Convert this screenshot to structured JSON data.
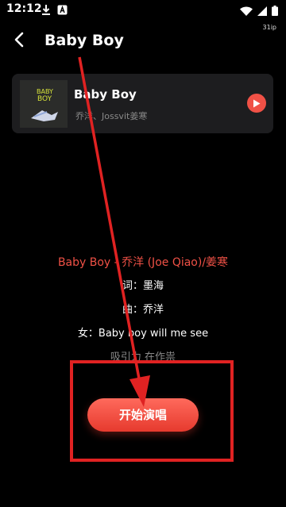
{
  "status_bar": {
    "time": "12:12",
    "net_speed": "31ip",
    "left_icons": [
      "download-icon",
      "a-badge-icon"
    ],
    "right_icons": [
      "wifi-icon",
      "signal-icon",
      "battery-icon"
    ]
  },
  "header": {
    "title": "Baby Boy"
  },
  "song_card": {
    "title": "Baby Boy",
    "artist": "乔洋、Jossvit姜寒",
    "cover_text": "BABY BOY"
  },
  "lyrics": [
    "Baby Boy - 乔洋 (Joe Qiao)/姜寒",
    "词：墨海",
    "曲：乔洋",
    "女：Baby boy will me see",
    "吸引力 在作祟"
  ],
  "start_button_label": "开始演唱",
  "colors": {
    "accent": "#f05146",
    "annotation": "#e02222",
    "card_bg": "#1d1d1f"
  }
}
